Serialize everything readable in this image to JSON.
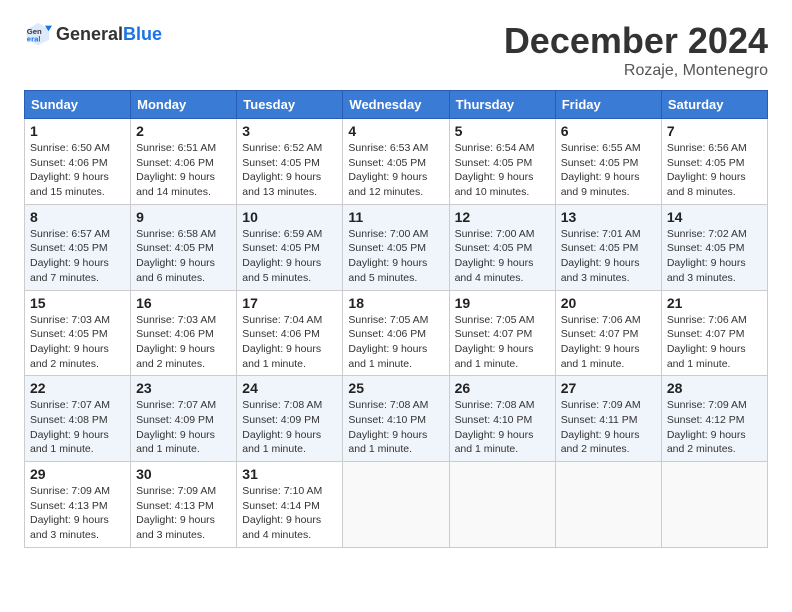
{
  "logo": {
    "text_general": "General",
    "text_blue": "Blue"
  },
  "title": "December 2024",
  "subtitle": "Rozaje, Montenegro",
  "days_of_week": [
    "Sunday",
    "Monday",
    "Tuesday",
    "Wednesday",
    "Thursday",
    "Friday",
    "Saturday"
  ],
  "weeks": [
    [
      {
        "day": 1,
        "rise": "6:50 AM",
        "set": "4:06 PM",
        "daylight": "9 hours and 15 minutes."
      },
      {
        "day": 2,
        "rise": "6:51 AM",
        "set": "4:06 PM",
        "daylight": "9 hours and 14 minutes."
      },
      {
        "day": 3,
        "rise": "6:52 AM",
        "set": "4:05 PM",
        "daylight": "9 hours and 13 minutes."
      },
      {
        "day": 4,
        "rise": "6:53 AM",
        "set": "4:05 PM",
        "daylight": "9 hours and 12 minutes."
      },
      {
        "day": 5,
        "rise": "6:54 AM",
        "set": "4:05 PM",
        "daylight": "9 hours and 10 minutes."
      },
      {
        "day": 6,
        "rise": "6:55 AM",
        "set": "4:05 PM",
        "daylight": "9 hours and 9 minutes."
      },
      {
        "day": 7,
        "rise": "6:56 AM",
        "set": "4:05 PM",
        "daylight": "9 hours and 8 minutes."
      }
    ],
    [
      {
        "day": 8,
        "rise": "6:57 AM",
        "set": "4:05 PM",
        "daylight": "9 hours and 7 minutes."
      },
      {
        "day": 9,
        "rise": "6:58 AM",
        "set": "4:05 PM",
        "daylight": "9 hours and 6 minutes."
      },
      {
        "day": 10,
        "rise": "6:59 AM",
        "set": "4:05 PM",
        "daylight": "9 hours and 5 minutes."
      },
      {
        "day": 11,
        "rise": "7:00 AM",
        "set": "4:05 PM",
        "daylight": "9 hours and 5 minutes."
      },
      {
        "day": 12,
        "rise": "7:00 AM",
        "set": "4:05 PM",
        "daylight": "9 hours and 4 minutes."
      },
      {
        "day": 13,
        "rise": "7:01 AM",
        "set": "4:05 PM",
        "daylight": "9 hours and 3 minutes."
      },
      {
        "day": 14,
        "rise": "7:02 AM",
        "set": "4:05 PM",
        "daylight": "9 hours and 3 minutes."
      }
    ],
    [
      {
        "day": 15,
        "rise": "7:03 AM",
        "set": "4:05 PM",
        "daylight": "9 hours and 2 minutes."
      },
      {
        "day": 16,
        "rise": "7:03 AM",
        "set": "4:06 PM",
        "daylight": "9 hours and 2 minutes."
      },
      {
        "day": 17,
        "rise": "7:04 AM",
        "set": "4:06 PM",
        "daylight": "9 hours and 1 minute."
      },
      {
        "day": 18,
        "rise": "7:05 AM",
        "set": "4:06 PM",
        "daylight": "9 hours and 1 minute."
      },
      {
        "day": 19,
        "rise": "7:05 AM",
        "set": "4:07 PM",
        "daylight": "9 hours and 1 minute."
      },
      {
        "day": 20,
        "rise": "7:06 AM",
        "set": "4:07 PM",
        "daylight": "9 hours and 1 minute."
      },
      {
        "day": 21,
        "rise": "7:06 AM",
        "set": "4:07 PM",
        "daylight": "9 hours and 1 minute."
      }
    ],
    [
      {
        "day": 22,
        "rise": "7:07 AM",
        "set": "4:08 PM",
        "daylight": "9 hours and 1 minute."
      },
      {
        "day": 23,
        "rise": "7:07 AM",
        "set": "4:09 PM",
        "daylight": "9 hours and 1 minute."
      },
      {
        "day": 24,
        "rise": "7:08 AM",
        "set": "4:09 PM",
        "daylight": "9 hours and 1 minute."
      },
      {
        "day": 25,
        "rise": "7:08 AM",
        "set": "4:10 PM",
        "daylight": "9 hours and 1 minute."
      },
      {
        "day": 26,
        "rise": "7:08 AM",
        "set": "4:10 PM",
        "daylight": "9 hours and 1 minute."
      },
      {
        "day": 27,
        "rise": "7:09 AM",
        "set": "4:11 PM",
        "daylight": "9 hours and 2 minutes."
      },
      {
        "day": 28,
        "rise": "7:09 AM",
        "set": "4:12 PM",
        "daylight": "9 hours and 2 minutes."
      }
    ],
    [
      {
        "day": 29,
        "rise": "7:09 AM",
        "set": "4:13 PM",
        "daylight": "9 hours and 3 minutes."
      },
      {
        "day": 30,
        "rise": "7:09 AM",
        "set": "4:13 PM",
        "daylight": "9 hours and 3 minutes."
      },
      {
        "day": 31,
        "rise": "7:10 AM",
        "set": "4:14 PM",
        "daylight": "9 hours and 4 minutes."
      },
      null,
      null,
      null,
      null
    ]
  ],
  "labels": {
    "sunrise": "Sunrise:",
    "sunset": "Sunset:",
    "daylight": "Daylight:"
  }
}
